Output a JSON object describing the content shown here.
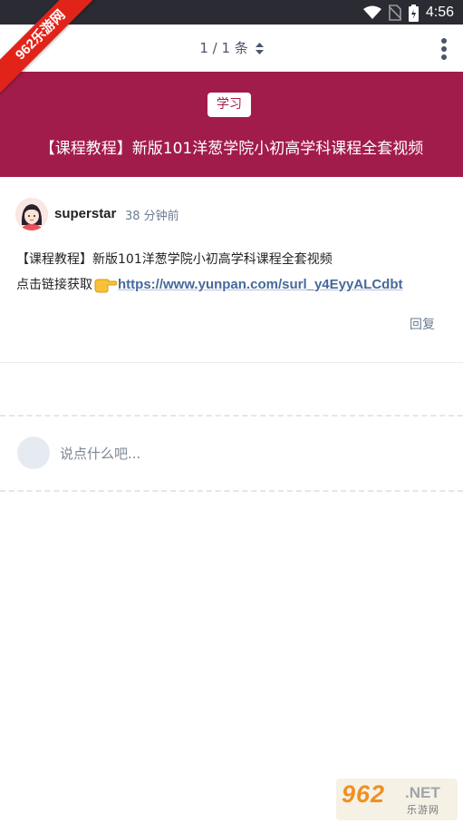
{
  "status_bar": {
    "time": "4:56"
  },
  "watermark": {
    "corner_text": "962乐游网",
    "bottom_num": "962",
    "bottom_net": ".NET",
    "bottom_cn": "乐游网"
  },
  "nav": {
    "counter": "1 / 1 条"
  },
  "header": {
    "tag": "学习",
    "title": "【课程教程】新版101洋葱学院小初高学科课程全套视频"
  },
  "post": {
    "author": "superstar",
    "time": "38 分钟前",
    "line1": "【课程教程】新版101洋葱学院小初高学科课程全套视频",
    "line2_prefix": "点击链接获取",
    "link": "https://www.yunpan.com/surl_y4EyyALCdbt",
    "reply_label": "回复"
  },
  "comment": {
    "placeholder": "说点什么吧..."
  },
  "colors": {
    "banner": "#a21c4b",
    "link": "#46699b",
    "status_bar": "#2b2b33"
  },
  "icons": [
    "wifi-icon",
    "no-sim-icon",
    "battery-icon",
    "back-icon",
    "sort-caret-icon",
    "more-vertical-icon",
    "pointing-hand-icon"
  ]
}
